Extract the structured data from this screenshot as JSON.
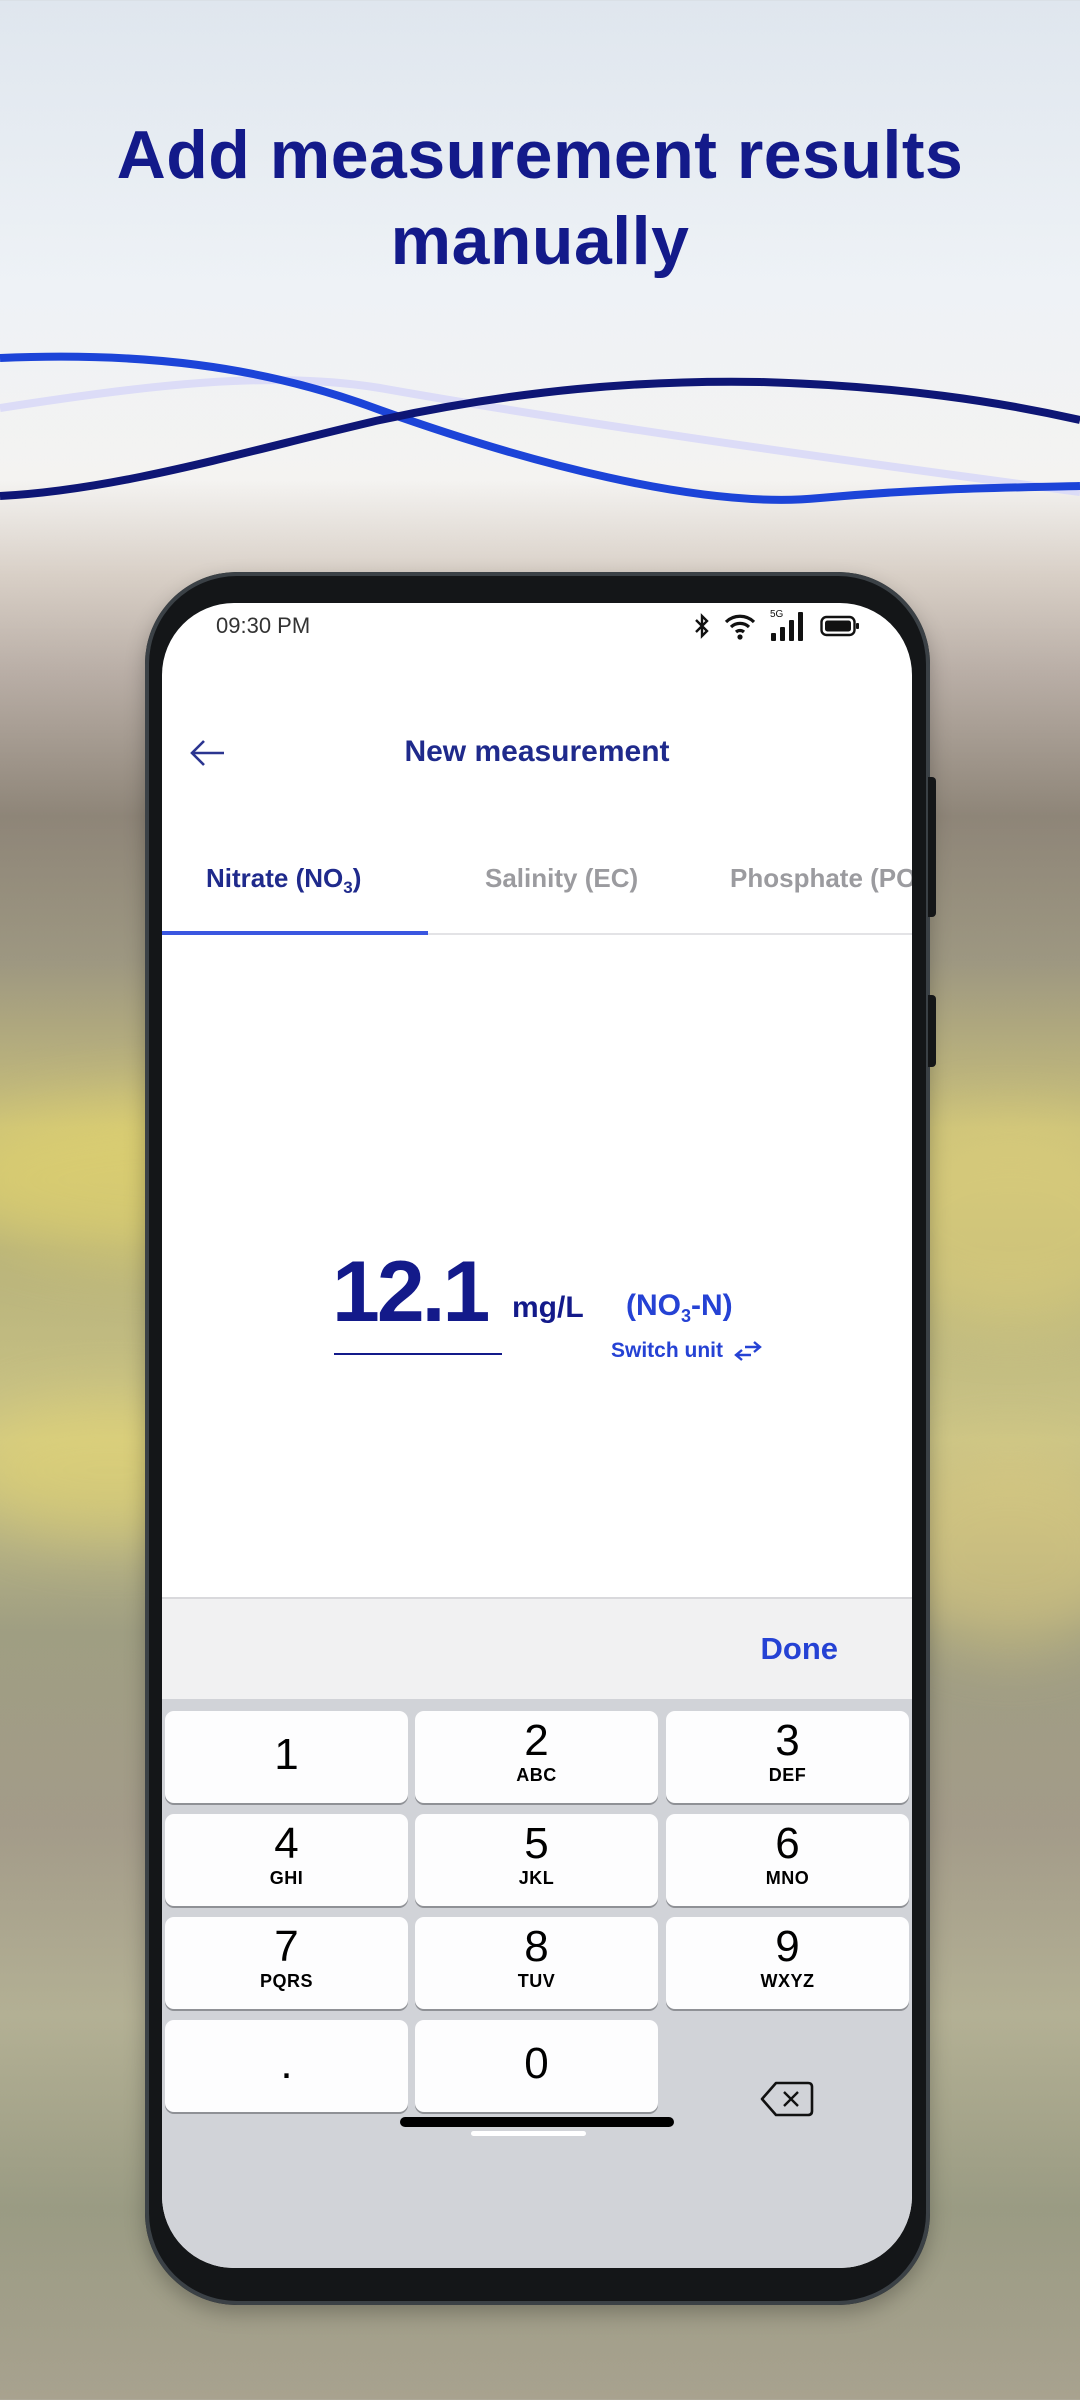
{
  "headline": {
    "line1": "Add measurement results",
    "line2": "manually"
  },
  "status_bar": {
    "time": "09:30 PM",
    "network_label": "5G",
    "icons": [
      "bluetooth-icon",
      "wifi-icon",
      "signal-5g-icon",
      "battery-icon"
    ]
  },
  "app_bar": {
    "title": "New measurement",
    "back_icon": "arrow-left-icon"
  },
  "tabs": [
    {
      "label": "Nitrate (NO",
      "sub": "3",
      "suffix": ")",
      "active": true
    },
    {
      "label": "Salinity (EC)",
      "active": false
    },
    {
      "label": "Phosphate (PO",
      "active": false
    }
  ],
  "measurement": {
    "value": "12.1",
    "unit": "mg/L",
    "form_prefix": "(NO",
    "form_sub": "3",
    "form_suffix": "-N)",
    "switch_label": "Switch unit",
    "switch_icon": "swap-arrows-icon"
  },
  "keyboard": {
    "done_label": "Done",
    "keys": [
      {
        "num": "1",
        "letters": ""
      },
      {
        "num": "2",
        "letters": "ABC"
      },
      {
        "num": "3",
        "letters": "DEF"
      },
      {
        "num": "4",
        "letters": "GHI"
      },
      {
        "num": "5",
        "letters": "JKL"
      },
      {
        "num": "6",
        "letters": "MNO"
      },
      {
        "num": "7",
        "letters": "PQRS"
      },
      {
        "num": "8",
        "letters": "TUV"
      },
      {
        "num": "9",
        "letters": "WXYZ"
      },
      {
        "num": ".",
        "letters": ""
      },
      {
        "num": "0",
        "letters": ""
      }
    ],
    "backspace_icon": "backspace-icon"
  },
  "colors": {
    "brand_dark": "#131a8a",
    "accent": "#2542d4",
    "tab_indicator": "#3a56e0"
  }
}
